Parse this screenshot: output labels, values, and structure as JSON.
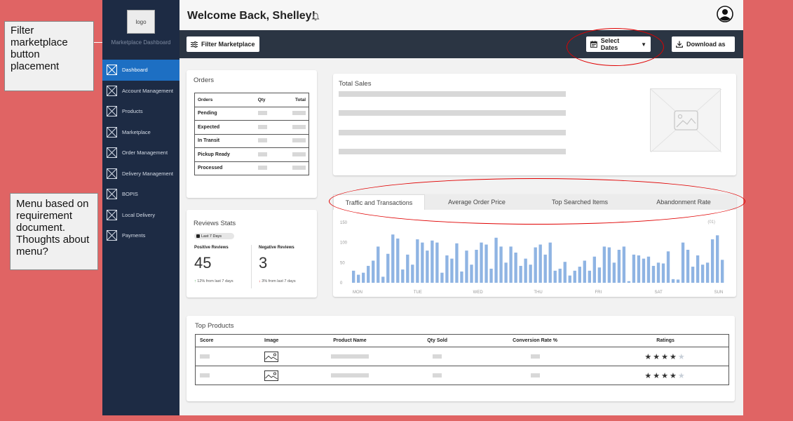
{
  "annotations": {
    "filter_note": "Filter marketplace button placement",
    "menu_note": "Menu based on requirement document. Thoughts about menu?"
  },
  "sidebar": {
    "logo_text": "logo",
    "brand": "Marketplace Dashboard",
    "items": [
      {
        "label": "Dashboard",
        "active": true,
        "icon": "placeholder-x-icon"
      },
      {
        "label": "Account Management",
        "active": false,
        "icon": "placeholder-x-icon"
      },
      {
        "label": "Products",
        "active": false,
        "icon": "placeholder-x-icon"
      },
      {
        "label": "Marketplace",
        "active": false,
        "icon": "placeholder-x-icon"
      },
      {
        "label": "Order Management",
        "active": false,
        "icon": "placeholder-x-icon"
      },
      {
        "label": "Delivery Management",
        "active": false,
        "icon": "placeholder-x-icon"
      },
      {
        "label": "BOPIS",
        "active": false,
        "icon": "placeholder-x-icon"
      },
      {
        "label": "Local Delivery",
        "active": false,
        "icon": "placeholder-x-icon"
      },
      {
        "label": "Payments",
        "active": false,
        "icon": "placeholder-x-icon"
      }
    ]
  },
  "header": {
    "welcome": "Welcome Back, Shelley!",
    "bell_icon": "bell-icon",
    "avatar_icon": "user-avatar-icon"
  },
  "toolbar": {
    "filter_label": "Filter Marketplace",
    "dates_label": "Select Dates",
    "download_label": "Download as"
  },
  "orders": {
    "title": "Orders",
    "columns": [
      "Orders",
      "Qty",
      "Total"
    ],
    "rows": [
      "Pending",
      "Expected",
      "In Transit",
      "Pickup Ready",
      "Processed"
    ]
  },
  "total_sales": {
    "title": "Total Sales"
  },
  "reviews": {
    "title": "Reviews Stats",
    "badge": "Last 7 Days",
    "positive_label": "Positive Reviews",
    "positive_value": "45",
    "positive_change": "12% from last 7 days",
    "negative_label": "Negative Reviews",
    "negative_value": "3",
    "negative_change": "3% from last 7 days",
    "up_color": "#2a9d3a",
    "down_color": "#d62828"
  },
  "traffic": {
    "tabs": [
      "Traffic and Transactions",
      "Average Order Price",
      "Top Searched Items",
      "Abandonment Rate"
    ],
    "active_tab": 0,
    "legend_fragment": "(01)"
  },
  "chart_data": {
    "type": "bar",
    "ylim": [
      0,
      150
    ],
    "yticks": [
      0,
      50,
      100,
      150
    ],
    "xticks": [
      "MON",
      "TUE",
      "WED",
      "THU",
      "FRI",
      "SAT",
      "SUN"
    ],
    "bar_color": "#8fb4e3",
    "values": [
      30,
      20,
      25,
      42,
      55,
      90,
      15,
      72,
      120,
      110,
      33,
      70,
      45,
      108,
      100,
      80,
      105,
      100,
      25,
      68,
      60,
      98,
      28,
      80,
      45,
      82,
      100,
      95,
      35,
      112,
      90,
      50,
      90,
      75,
      42,
      60,
      45,
      88,
      95,
      70,
      100,
      30,
      35,
      52,
      18,
      30,
      40,
      55,
      30,
      65,
      38,
      90,
      88,
      50,
      82,
      90,
      4,
      70,
      68,
      60,
      65,
      42,
      50,
      48,
      78,
      9,
      8,
      100,
      82,
      40,
      68,
      45,
      50,
      108,
      118,
      57
    ]
  },
  "top_products": {
    "title": "Top Products",
    "columns": [
      "Score",
      "Image",
      "Product Name",
      "Qty Sold",
      "Conversion Rate %",
      "Ratings"
    ],
    "rows": [
      {
        "rating": 4,
        "max": 5
      },
      {
        "rating": 4,
        "max": 5
      }
    ]
  },
  "highlight_color": "#e00000"
}
